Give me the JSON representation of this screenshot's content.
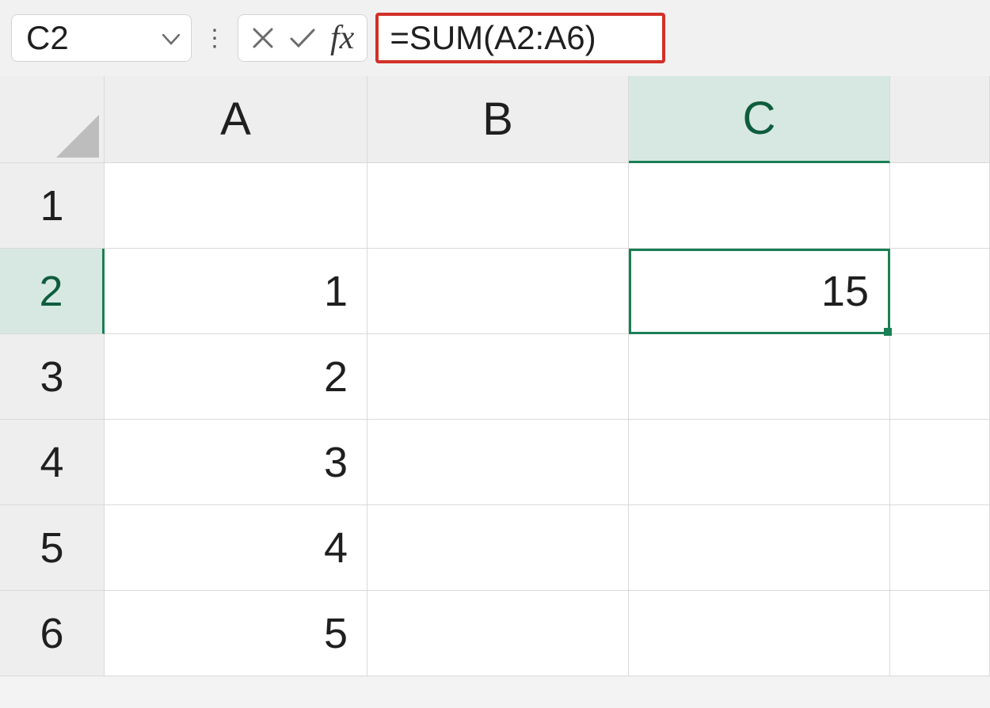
{
  "formula_bar": {
    "name_box": "C2",
    "fx_label": "fx",
    "formula": "=SUM(A2:A6)"
  },
  "columns": [
    "A",
    "B",
    "C"
  ],
  "rows": [
    "1",
    "2",
    "3",
    "4",
    "5",
    "6"
  ],
  "selected_cell": "C2",
  "cells": {
    "A1": "",
    "B1": "",
    "C1": "",
    "A2": "1",
    "B2": "",
    "C2": "15",
    "A3": "2",
    "B3": "",
    "C3": "",
    "A4": "3",
    "B4": "",
    "C4": "",
    "A5": "4",
    "B5": "",
    "C5": "",
    "A6": "5",
    "B6": "",
    "C6": ""
  }
}
